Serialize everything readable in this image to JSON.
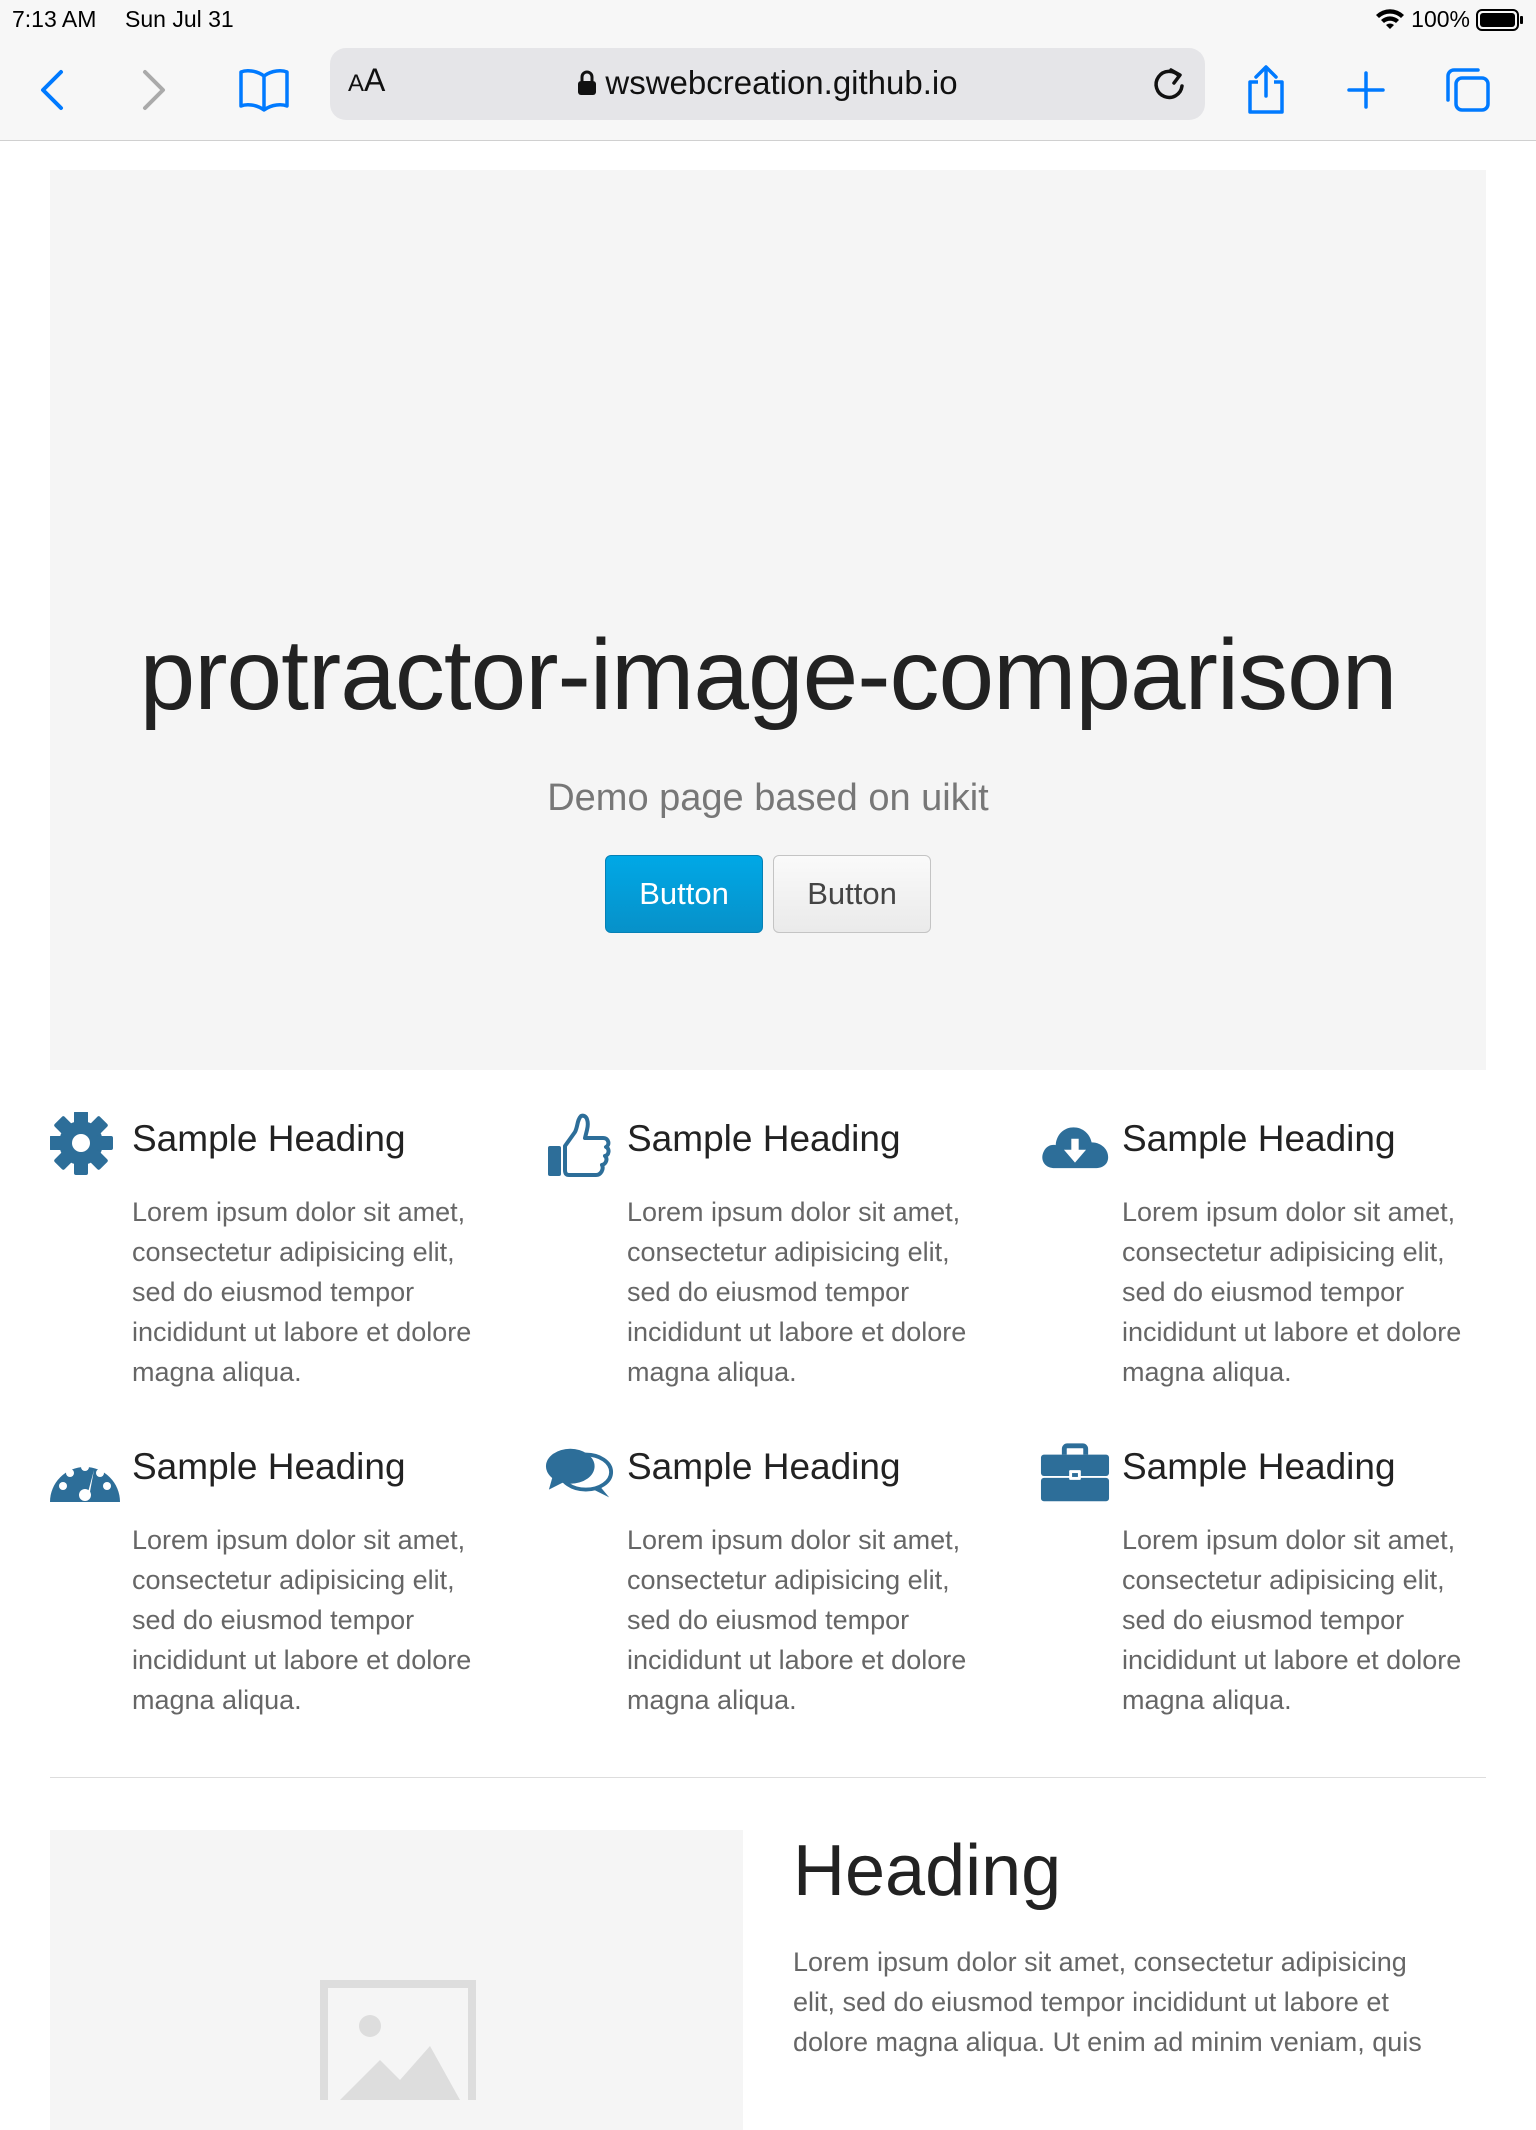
{
  "status_bar": {
    "time": "7:13 AM",
    "date": "Sun Jul 31",
    "battery": "100%"
  },
  "toolbar": {
    "text_size_label_small": "A",
    "text_size_label_large": "A",
    "url": "wswebcreation.github.io"
  },
  "hero": {
    "title": "protractor-image-comparison",
    "subtitle": "Demo page based on uikit",
    "primary_button": "Button",
    "default_button": "Button"
  },
  "features": [
    {
      "icon": "gear-icon",
      "heading": "Sample Heading",
      "text": "Lorem ipsum dolor sit amet, consectetur adipisicing elit, sed do eiusmod tempor incididunt ut labore et dolore magna aliqua."
    },
    {
      "icon": "thumbs-up-icon",
      "heading": "Sample Heading",
      "text": "Lorem ipsum dolor sit amet, consectetur adipisicing elit, sed do eiusmod tempor incididunt ut labore et dolore magna aliqua."
    },
    {
      "icon": "cloud-download-icon",
      "heading": "Sample Heading",
      "text": "Lorem ipsum dolor sit amet, consectetur adipisicing elit, sed do eiusmod tempor incididunt ut labore et dolore magna aliqua."
    },
    {
      "icon": "dashboard-icon",
      "heading": "Sample Heading",
      "text": "Lorem ipsum dolor sit amet, consectetur adipisicing elit, sed do eiusmod tempor incididunt ut labore et dolore magna aliqua."
    },
    {
      "icon": "comments-icon",
      "heading": "Sample Heading",
      "text": "Lorem ipsum dolor sit amet, consectetur adipisicing elit, sed do eiusmod tempor incididunt ut labore et dolore magna aliqua."
    },
    {
      "icon": "briefcase-icon",
      "heading": "Sample Heading",
      "text": "Lorem ipsum dolor sit amet, consectetur adipisicing elit, sed do eiusmod tempor incididunt ut labore et dolore magna aliqua."
    }
  ],
  "bottom": {
    "heading": "Heading",
    "text": "Lorem ipsum dolor sit amet, consectetur adipisicing elit, sed do eiusmod tempor incididunt ut labore et dolore magna aliqua. Ut enim ad minim veniam, quis"
  },
  "colors": {
    "accent": "#007aff",
    "icon_blue": "#2d6e99",
    "primary_button": "#00a8e6"
  }
}
